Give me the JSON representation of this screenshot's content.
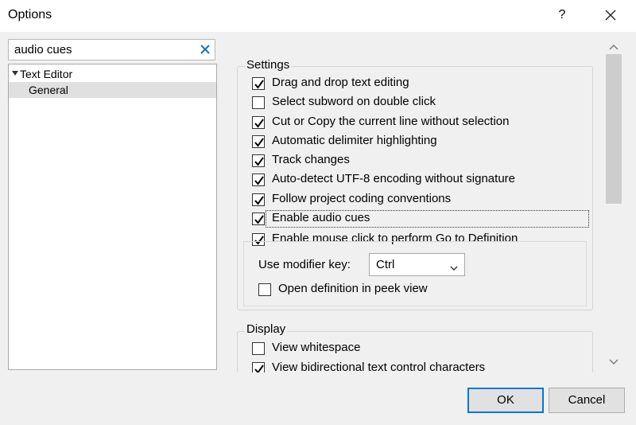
{
  "window": {
    "title": "Options",
    "help_label": "?",
    "close_icon": "close-icon"
  },
  "search": {
    "value": "audio cues",
    "clear_icon": "clear-icon"
  },
  "tree": {
    "root_label": "Text Editor",
    "child_label": "General",
    "selected": "General"
  },
  "settings": {
    "heading": "Settings",
    "options": [
      {
        "label": "Drag and drop text editing",
        "checked": true
      },
      {
        "label": "Select subword on double click",
        "checked": false
      },
      {
        "label": "Cut or Copy the current line without selection",
        "checked": true
      },
      {
        "label": "Automatic delimiter highlighting",
        "checked": true
      },
      {
        "label": "Track changes",
        "checked": true
      },
      {
        "label": "Auto-detect UTF-8 encoding without signature",
        "checked": true
      },
      {
        "label": "Follow project coding conventions",
        "checked": true
      },
      {
        "label": "Enable audio cues",
        "checked": true
      },
      {
        "label": "Enable mouse click to perform Go to Definition",
        "checked": true
      }
    ],
    "modifier_label": "Use modifier key:",
    "modifier_value": "Ctrl",
    "peek_label": "Open definition in peek view",
    "peek_checked": false
  },
  "display": {
    "heading": "Display",
    "options": [
      {
        "label": "View whitespace",
        "checked": false
      },
      {
        "label": "View bidirectional text control characters",
        "checked": true
      }
    ]
  },
  "buttons": {
    "ok": "OK",
    "cancel": "Cancel"
  },
  "colors": {
    "accent": "#0078d7",
    "selection": "#e0e0e0"
  }
}
